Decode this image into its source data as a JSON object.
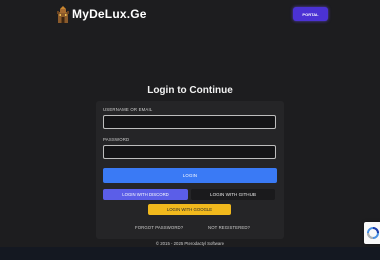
{
  "header": {
    "brand": "MyDeLux.Ge",
    "logo_icon": "castle-logo-icon",
    "portal_button": "PORTAL"
  },
  "login": {
    "title": "Login to Continue",
    "username_label": "USERNAME OR EMAIL",
    "username_value": "",
    "password_label": "PASSWORD",
    "password_value": "",
    "login_button": "LOGIN",
    "discord_button": "LOGIN WITH DISCORD",
    "github_button": "LOGIN WITH GITHUB",
    "google_button": "LOGIN WITH GOOGLE",
    "forgot_link": "FORGOT PASSWORD?",
    "register_link": "NOT REGISTERED?"
  },
  "footer": {
    "copyright": "© 2015 - 2025 Pterodactyl Software"
  },
  "colors": {
    "background": "#1d1d1f",
    "accent": "#4b32d4",
    "primary_button": "#3a7af5",
    "discord": "#5b5ee8",
    "google": "#f1b91d"
  }
}
